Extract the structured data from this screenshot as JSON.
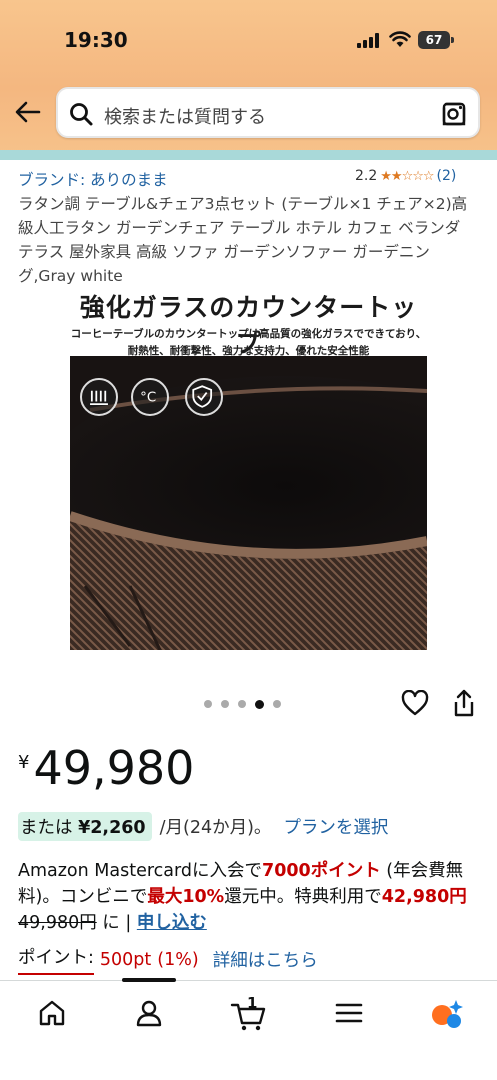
{
  "status_bar": {
    "time": "19:30",
    "battery": "67"
  },
  "search": {
    "placeholder": "検索または質問する"
  },
  "product": {
    "brand": "ブランド: ありのまま",
    "rating_value": "2.2",
    "stars": "★★☆☆☆",
    "rating_count": "(2)",
    "title": "ラタン調 テーブル&チェア3点セット (テーブル×1 チェア×2)高級人工ラタン ガーデンチェア テーブル ホテル カフェ ベランダ テラス 屋外家具 高級 ソファ ガーデンソファー ガーデニング,Gray white"
  },
  "hero": {
    "heading": "強化ガラスのカウンタートップ",
    "subline1": "コーヒーテーブルのカウンタートップは高品質の強化ガラスでできており、",
    "subline2": "耐熱性、耐衝撃性、強力な支持力、優れた安全性能",
    "feature_icons": [
      "heat-resistance-icon",
      "temperature-celsius-icon",
      "shield-check-icon"
    ],
    "image_count": 5,
    "active_index": 3
  },
  "price": {
    "currency": "¥",
    "value": "49,980"
  },
  "installment": {
    "or": "または",
    "amount": "¥2,260",
    "period": "/月(24か月)。",
    "plan_link": "プランを選択"
  },
  "promo": {
    "p1": "Amazon Mastercardに入会で",
    "points": "7000ポイント",
    "p2": " (年会費無料)。コンビニで",
    "discount": "最大10%",
    "p3": "還元中。特典利用で",
    "new_price": "42,980円",
    "old_price": "49,980円",
    "p4": " に | ",
    "apply": "申し込む"
  },
  "points": {
    "label": "ポイント:",
    "value": "500pt",
    "percent": "(1%)",
    "details": "詳細はこちら"
  },
  "nav": {
    "items": [
      "home-icon",
      "account-icon",
      "cart-icon",
      "menu-icon",
      "rufus-icon"
    ],
    "cart_count": "1"
  },
  "colors": {
    "header_bg": "#f4b780",
    "link": "#2162a1",
    "deal_red": "#c40000",
    "installment_bg": "#d7f2e7",
    "star": "#de7921"
  }
}
